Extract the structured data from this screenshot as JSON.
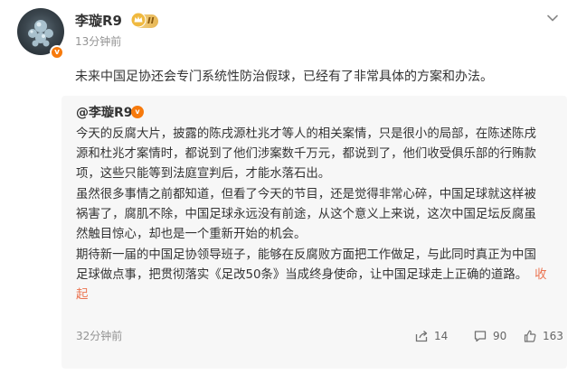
{
  "post": {
    "author": "李璇R9",
    "verified_mark": "v",
    "level_badge": "II",
    "time": "13分钟前",
    "text": "未来中国足协还会专门系统性防治假球，已经有了非常具体的方案和办法。"
  },
  "repost": {
    "author": "@李璇R9",
    "verified_mark": "v",
    "paragraphs": [
      {
        "lines": [
          "今天的反腐大片，披露的陈戌源杜兆才等人的相关案情，只是很小的局部，在陈述陈戌",
          "源和杜兆才案情时，都说到了他们涉案数千万元，都说到了，他们收受俱乐部的行贿款",
          "项，这些只能等到法庭宣判后，才能水落石出。"
        ]
      },
      {
        "lines": [
          "虽然很多事情之前都知道，但看了今天的节目，还是觉得非常心碎，中国足球就这样被",
          "祸害了，腐肌不除，中国足球永远没有前途，从这个意义上来说，这次中国足坛反腐虽",
          "然触目惊心，却也是一个重新开始的机会。"
        ]
      },
      {
        "lines": [
          "期待新一届的中国足协领导班子，能够在反腐败方面把工作做足，与此同时真正为中国",
          "足球做点事，把贯彻落实《足改50条》当成终身使命，让中国足球走上正确的道路。"
        ],
        "collapse_part1": "收",
        "collapse_part2": "起"
      }
    ],
    "time": "32分钟前",
    "actions": {
      "share_count": "14",
      "comment_count": "90",
      "like_count": "163"
    }
  },
  "icons": {
    "more": "chevron-down-icon",
    "share": "share-icon",
    "comment": "comment-icon",
    "like": "thumbs-up-icon"
  },
  "colors": {
    "accent_orange": "#f77a0c",
    "collapse_link": "#eb7350",
    "muted_text": "#939393"
  }
}
